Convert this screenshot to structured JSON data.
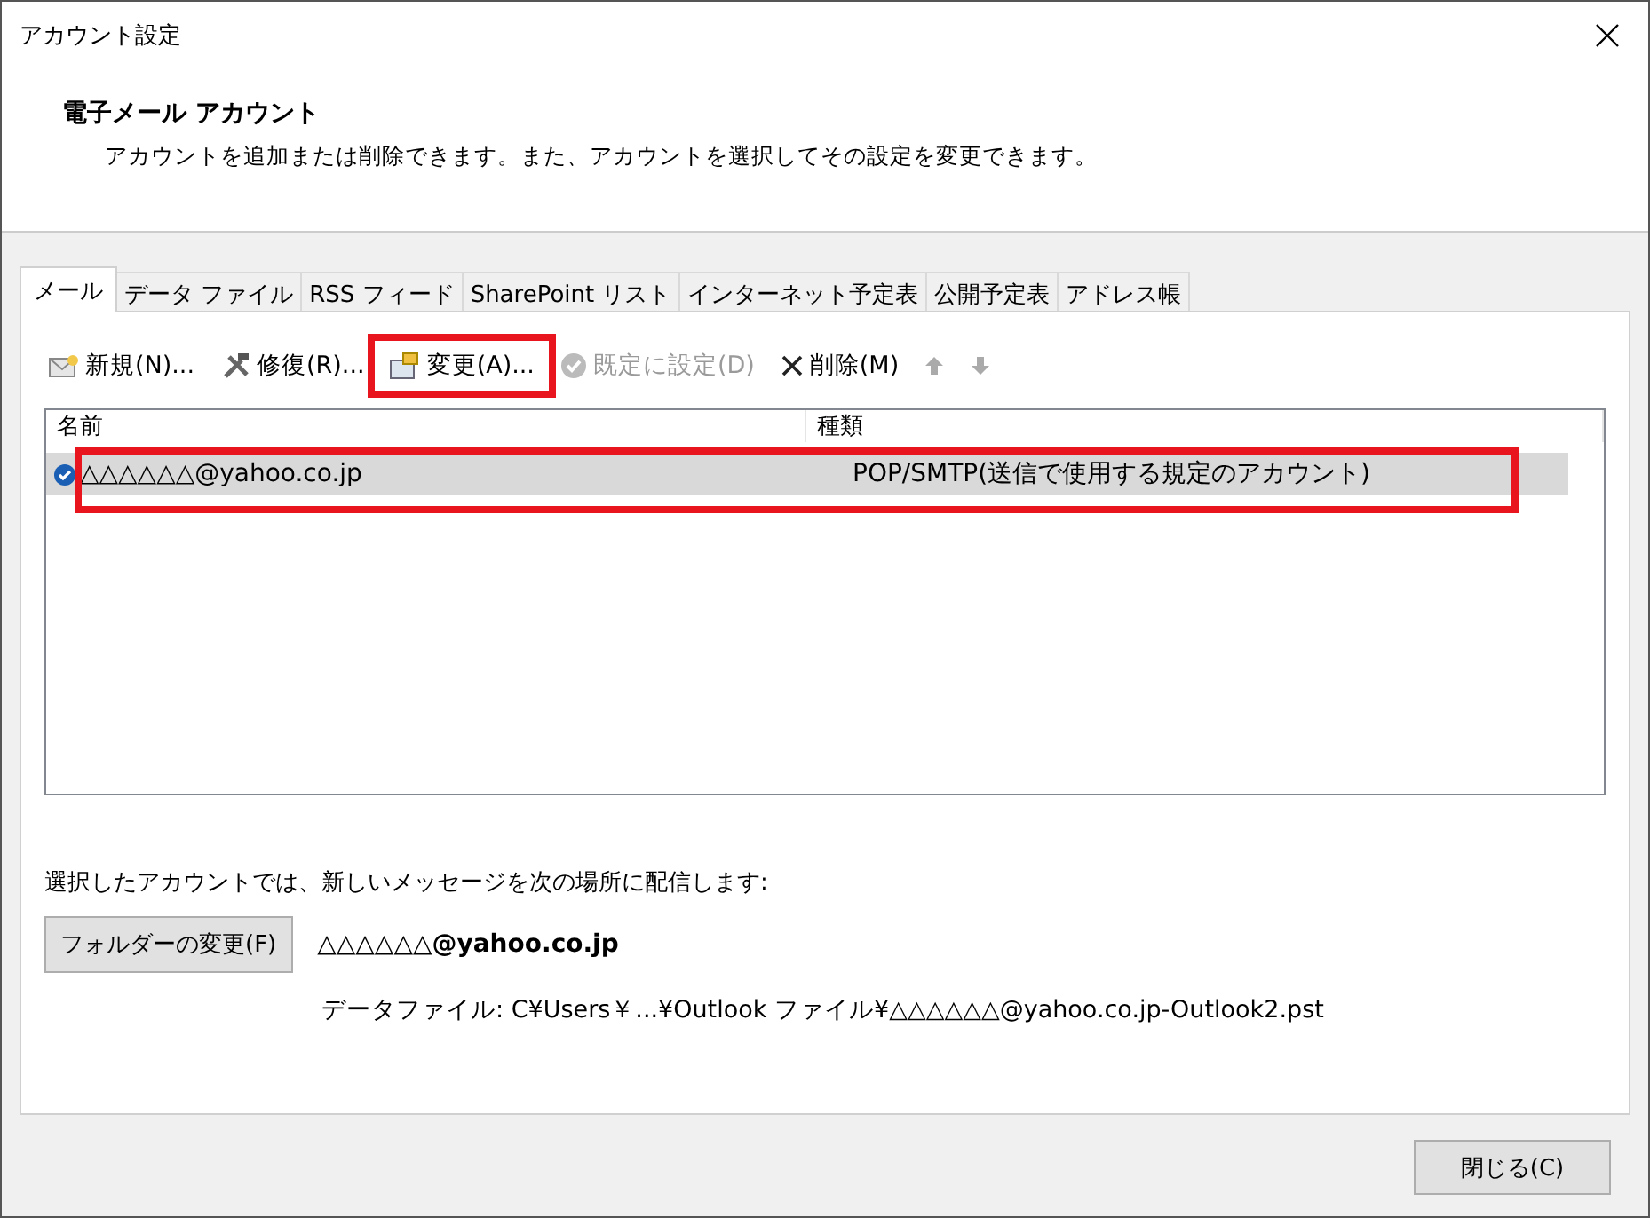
{
  "window": {
    "title": "アカウント設定"
  },
  "header": {
    "title": "電子メール アカウント",
    "description": "アカウントを追加または削除できます。また、アカウントを選択してその設定を変更できます。"
  },
  "tabs": [
    {
      "label": "メール",
      "selected": true
    },
    {
      "label": "データ ファイル",
      "selected": false
    },
    {
      "label": "RSS フィード",
      "selected": false
    },
    {
      "label": "SharePoint リスト",
      "selected": false
    },
    {
      "label": "インターネット予定表",
      "selected": false
    },
    {
      "label": "公開予定表",
      "selected": false
    },
    {
      "label": "アドレス帳",
      "selected": false
    }
  ],
  "toolbar": [
    {
      "kind": "new",
      "label": "新規(N)...",
      "disabled": false
    },
    {
      "kind": "repair",
      "label": "修復(R)...",
      "disabled": false
    },
    {
      "kind": "change",
      "label": "変更(A)...",
      "disabled": false,
      "highlighted": true
    },
    {
      "kind": "default",
      "label": "既定に設定(D)",
      "disabled": true
    },
    {
      "kind": "delete",
      "label": "削除(M)",
      "disabled": false
    },
    {
      "kind": "up",
      "disabled": true
    },
    {
      "kind": "down",
      "disabled": true
    }
  ],
  "table": {
    "columns": [
      "名前",
      "種類"
    ],
    "rows": [
      {
        "name": "△△△△△△@yahoo.co.jp",
        "type": "POP/SMTP(送信で使用する規定のアカウント)",
        "default": true,
        "selected": true,
        "highlighted": true
      }
    ]
  },
  "delivery": {
    "text": "選択したアカウントでは、新しいメッセージを次の場所に配信します:",
    "button": "フォルダーの変更(F)",
    "account": "△△△△△△@yahoo.co.jp",
    "data_file": "データファイル: C¥Users￥...¥Outlook ファイル¥△△△△△△@yahoo.co.jp-Outlook2.pst"
  },
  "buttons": [
    "閉じる(C)"
  ]
}
